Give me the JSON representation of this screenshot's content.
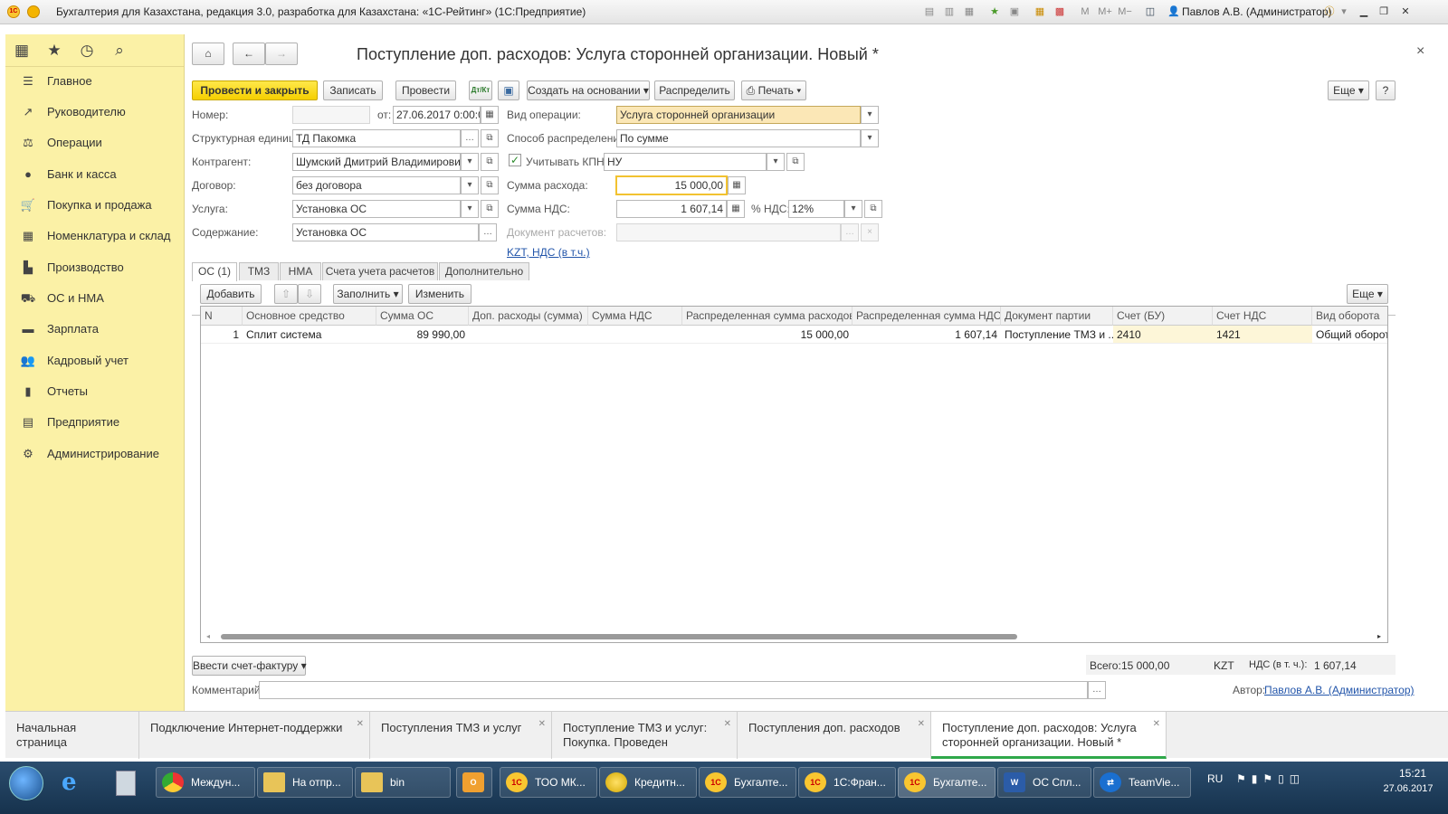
{
  "window": {
    "title": "Бухгалтерия для Казахстана, редакция 3.0, разработка для Казахстана: «1С-Рейтинг» (1С:Предприятие)",
    "user": "Павлов А.В. (Администратор)",
    "logo_text": "1С",
    "icons": {
      "user": "user-icon",
      "info": "info-icon",
      "minimize": "minimize-icon",
      "restore": "restore-icon",
      "close": "close-icon",
      "m": "M",
      "mplus": "M+",
      "mminus": "M−"
    }
  },
  "sidebar": {
    "top_icons": [
      "grid-icon",
      "star-icon",
      "history-icon",
      "search-icon"
    ],
    "items": [
      {
        "label": "Главное",
        "icon": "menu-icon"
      },
      {
        "label": "Руководителю",
        "icon": "chart-icon"
      },
      {
        "label": "Операции",
        "icon": "operations-icon"
      },
      {
        "label": "Банк и касса",
        "icon": "bank-icon"
      },
      {
        "label": "Покупка и продажа",
        "icon": "cart-icon"
      },
      {
        "label": "Номенклатура и склад",
        "icon": "warehouse-icon"
      },
      {
        "label": "Производство",
        "icon": "production-icon"
      },
      {
        "label": "ОС и НМА",
        "icon": "truck-icon"
      },
      {
        "label": "Зарплата",
        "icon": "salary-icon"
      },
      {
        "label": "Кадровый учет",
        "icon": "people-icon"
      },
      {
        "label": "Отчеты",
        "icon": "reports-icon"
      },
      {
        "label": "Предприятие",
        "icon": "enterprise-icon"
      },
      {
        "label": "Администрирование",
        "icon": "gear-icon"
      }
    ]
  },
  "doc": {
    "title": "Поступление доп. расходов: Услуга сторонней организации. Новый *",
    "close": "×",
    "toolbar": {
      "post_close": "Провести и закрыть",
      "save": "Записать",
      "post": "Провести",
      "dtkt": "Дт/Кт",
      "create_based": "Создать на основании",
      "distribute": "Распределить",
      "print": "Печать",
      "more": "Еще",
      "help": "?"
    },
    "fields": {
      "number_label": "Номер:",
      "number_value": "",
      "date_label": "от:",
      "date_value": "27.06.2017  0:00:00",
      "struct_label": "Структурная единица:",
      "struct_value": "ТД Пакомка",
      "counterparty_label": "Контрагент:",
      "counterparty_value": "Шумский Дмитрий Владимирович",
      "contract_label": "Договор:",
      "contract_value": "без договора",
      "service_label": "Услуга:",
      "service_value": "Установка ОС",
      "content_label": "Содержание:",
      "content_value": "Установка ОС",
      "op_type_label": "Вид операции:",
      "op_type_value": "Услуга сторонней организации",
      "dist_label": "Способ распределения:",
      "dist_value": "По сумме",
      "kpn_label": "Учитывать КПН",
      "kpn_checked": true,
      "kpn_value": "НУ",
      "amount_label": "Сумма расхода:",
      "amount_value": "15 000,00",
      "vat_label": "Сумма НДС:",
      "vat_value": "1 607,14",
      "vat_rate_label": "% НДС:",
      "vat_rate_value": "12%",
      "settle_label": "Документ расчетов:",
      "settle_value": "",
      "currency_link": "KZT, НДС (в т.ч.)"
    },
    "tabs": [
      "ОС (1)",
      "ТМЗ",
      "НМА",
      "Счета учета расчетов",
      "Дополнительно"
    ],
    "grid_toolbar": {
      "add": "Добавить",
      "fill": "Заполнить",
      "change": "Изменить",
      "more": "Еще"
    },
    "table": {
      "columns": [
        "N",
        "Основное средство",
        "Сумма ОС",
        "Доп. расходы (сумма)",
        "Сумма НДС",
        "Распределенная сумма расходов",
        "Распределенная сумма НДС",
        "Документ партии",
        "Счет (БУ)",
        "Счет НДС",
        "Вид оборота"
      ],
      "rows": [
        [
          "1",
          "Сплит система",
          "89 990,00",
          "",
          "",
          "15 000,00",
          "1 607,14",
          "Поступление ТМЗ и ...",
          "2410",
          "1421",
          "Общий оборот"
        ]
      ]
    },
    "footer": {
      "invoice_btn": "Ввести счет-фактуру",
      "total_label": "Всего:",
      "total_value": "15 000,00",
      "currency": "KZT",
      "vat_total_label": "НДС (в т. ч.):",
      "vat_total_value": "1 607,14",
      "comment_label": "Комментарий:",
      "comment_value": "",
      "author_label": "Автор:",
      "author_value": "Павлов А.В. (Администратор)"
    }
  },
  "window_tabs": [
    {
      "label": "Начальная страница",
      "closable": false
    },
    {
      "label": "Подключение Интернет-поддержки",
      "closable": true
    },
    {
      "label": "Поступления ТМЗ и услуг",
      "closable": true
    },
    {
      "label": "Поступление ТМЗ и услуг: Покупка. Проведен",
      "closable": true
    },
    {
      "label": "Поступления доп. расходов",
      "closable": true
    },
    {
      "label": "Поступление доп. расходов: Услуга сторонней организации. Новый *",
      "closable": true,
      "active": true
    }
  ],
  "taskbar": {
    "items": [
      "Междун...",
      "На отпр...",
      "bin",
      "",
      "ТОО МК...",
      "Кредитн...",
      "Бухгалте...",
      "1С:Фран...",
      "Бухгалте...",
      "ОС Спл...",
      "TeamVie..."
    ],
    "lang": "RU",
    "time": "15:21",
    "date": "27.06.2017"
  }
}
